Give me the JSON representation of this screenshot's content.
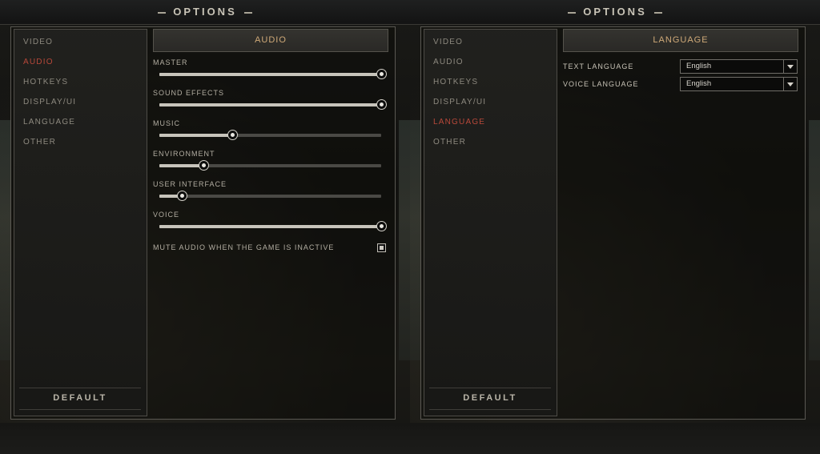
{
  "left_screen": {
    "title": "OPTIONS",
    "nav_items": [
      {
        "label": "VIDEO",
        "active": false
      },
      {
        "label": "AUDIO",
        "active": true
      },
      {
        "label": "HOTKEYS",
        "active": false
      },
      {
        "label": "DISPLAY/UI",
        "active": false
      },
      {
        "label": "LANGUAGE",
        "active": false
      },
      {
        "label": "OTHER",
        "active": false
      }
    ],
    "default_label": "DEFAULT",
    "panel_title": "AUDIO",
    "sliders": [
      {
        "label": "MASTER",
        "value_fraction": 1.0
      },
      {
        "label": "SOUND EFFECTS",
        "value_fraction": 1.0
      },
      {
        "label": "MUSIC",
        "value_fraction": 0.33
      },
      {
        "label": "ENVIRONMENT",
        "value_fraction": 0.2
      },
      {
        "label": "USER INTERFACE",
        "value_fraction": 0.1
      },
      {
        "label": "VOICE",
        "value_fraction": 1.0
      }
    ],
    "mute_label": "MUTE AUDIO WHEN THE GAME IS INACTIVE",
    "mute_checked": true
  },
  "right_screen": {
    "title": "OPTIONS",
    "nav_items": [
      {
        "label": "VIDEO",
        "active": false
      },
      {
        "label": "AUDIO",
        "active": false
      },
      {
        "label": "HOTKEYS",
        "active": false
      },
      {
        "label": "DISPLAY/UI",
        "active": false
      },
      {
        "label": "LANGUAGE",
        "active": true
      },
      {
        "label": "OTHER",
        "active": false
      }
    ],
    "default_label": "DEFAULT",
    "panel_title": "LANGUAGE",
    "settings": [
      {
        "label": "TEXT LANGUAGE",
        "value": "English"
      },
      {
        "label": "VOICE LANGUAGE",
        "value": "English"
      }
    ]
  },
  "colors": {
    "active_nav": "#b8483a",
    "header_text": "#cfa978"
  }
}
